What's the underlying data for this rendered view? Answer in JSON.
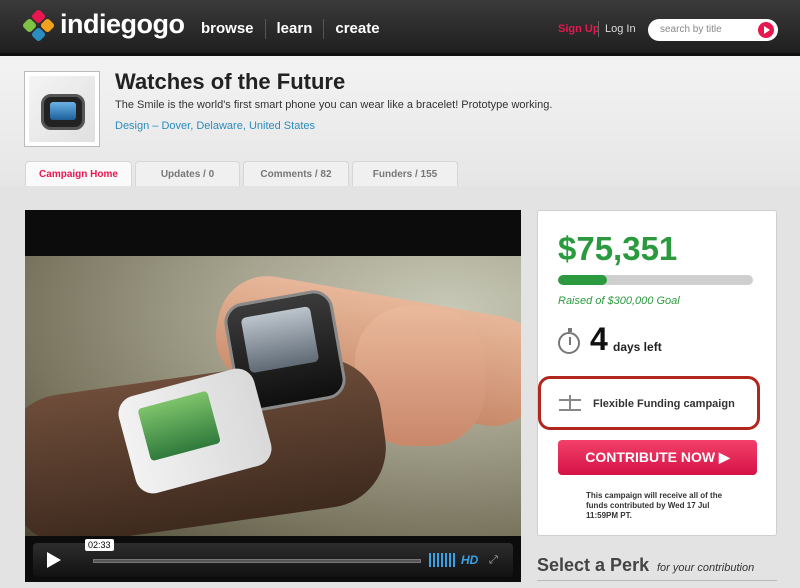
{
  "nav": {
    "logo": "indiegogo",
    "items": [
      "browse",
      "learn",
      "create"
    ],
    "signup": "Sign Up",
    "login": "Log In",
    "search_placeholder": "search by title"
  },
  "campaign": {
    "title": "Watches of the Future",
    "subtitle": "The Smile is the world's first smart phone you can wear like a bracelet! Prototype working.",
    "category": "Design",
    "location_sep": " – ",
    "city": "Dover",
    "state": "Delaware",
    "country": "United States"
  },
  "tabs": [
    "Campaign Home",
    "Updates / 0",
    "Comments / 82",
    "Funders / 155"
  ],
  "video": {
    "time": "02:33",
    "hd": "HD",
    "fullscreen": "⤢"
  },
  "funding": {
    "raised": "$75,351",
    "progress": 0.25,
    "goal_text": "Raised of $300,000 Goal",
    "days": "4",
    "days_label": "days left",
    "flex_label": "Flexible Funding campaign",
    "contribute": "CONTRIBUTE NOW ▶",
    "note": "This campaign will receive all of the funds contributed by Wed 17 Jul 11:59PM PT."
  },
  "perk": {
    "title": "Select a Perk",
    "subtitle": "for your contribution"
  },
  "colors": {
    "brand": "#e8174f",
    "green": "#2b9a3f",
    "link": "#2a8cbf",
    "highlight": "#b3261e"
  }
}
